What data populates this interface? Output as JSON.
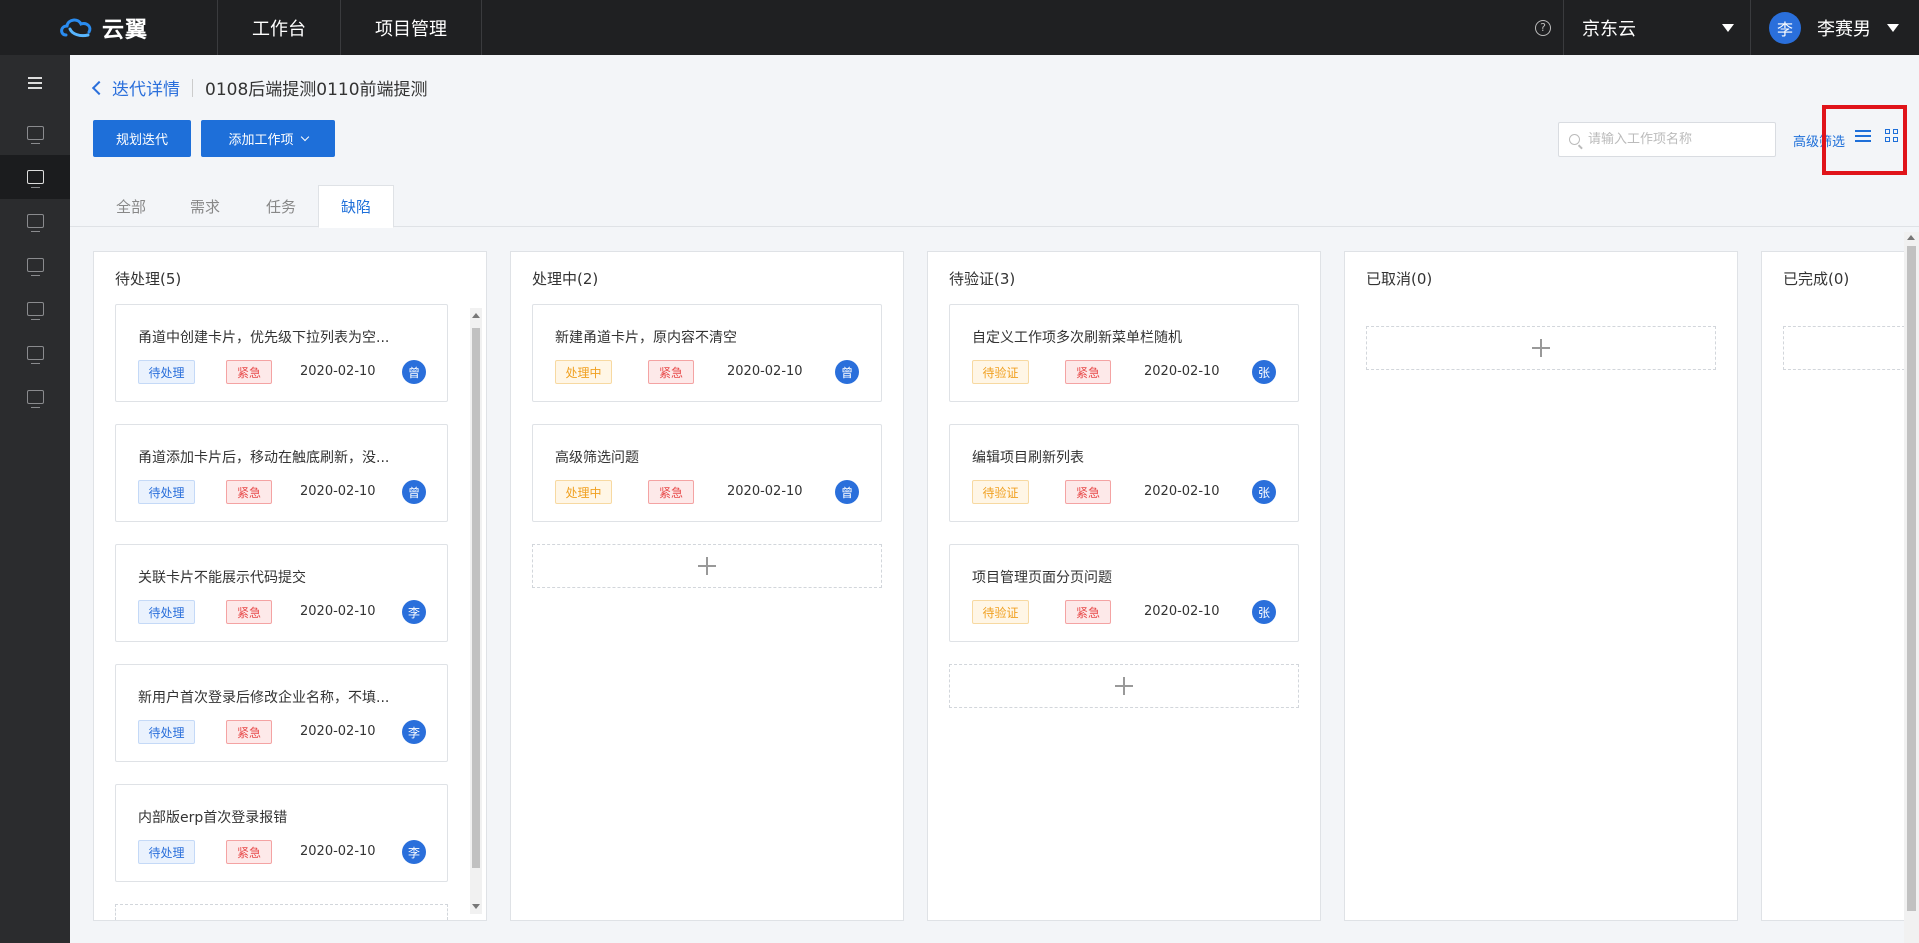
{
  "app": {
    "name": "云翼"
  },
  "top_nav": [
    {
      "label": "工作台"
    },
    {
      "label": "项目管理"
    }
  ],
  "org": {
    "name": "京东云"
  },
  "user": {
    "avatar": "李",
    "name": "李赛男"
  },
  "breadcrumb": {
    "back": "迭代详情",
    "title": "0108后端提测0110前端提测"
  },
  "toolbar": {
    "plan_label": "规划迭代",
    "add_label": "添加工作项",
    "search_placeholder": "请输入工作项名称",
    "advanced_filter": "高级筛选"
  },
  "tabs": [
    {
      "label": "全部"
    },
    {
      "label": "需求"
    },
    {
      "label": "任务"
    },
    {
      "label": "缺陷"
    }
  ],
  "columns": [
    {
      "title": "待处理(5)",
      "cards": [
        {
          "title": "甬道中创建卡片，优先级下拉列表为空...",
          "status": "待处理",
          "priority": "紧急",
          "date": "2020-02-10",
          "assignee": "曾"
        },
        {
          "title": "甬道添加卡片后，移动在触底刷新，没...",
          "status": "待处理",
          "priority": "紧急",
          "date": "2020-02-10",
          "assignee": "曾"
        },
        {
          "title": "关联卡片不能展示代码提交",
          "status": "待处理",
          "priority": "紧急",
          "date": "2020-02-10",
          "assignee": "李"
        },
        {
          "title": "新用户首次登录后修改企业名称，不填...",
          "status": "待处理",
          "priority": "紧急",
          "date": "2020-02-10",
          "assignee": "李"
        },
        {
          "title": "内部版erp首次登录报错",
          "status": "待处理",
          "priority": "紧急",
          "date": "2020-02-10",
          "assignee": "李"
        }
      ]
    },
    {
      "title": "处理中(2)",
      "cards": [
        {
          "title": "新建甬道卡片，原内容不清空",
          "status": "处理中",
          "priority": "紧急",
          "date": "2020-02-10",
          "assignee": "曾"
        },
        {
          "title": "高级筛选问题",
          "status": "处理中",
          "priority": "紧急",
          "date": "2020-02-10",
          "assignee": "曾"
        }
      ]
    },
    {
      "title": "待验证(3)",
      "cards": [
        {
          "title": "自定义工作项多次刷新菜单栏随机",
          "status": "待验证",
          "priority": "紧急",
          "date": "2020-02-10",
          "assignee": "张"
        },
        {
          "title": "编辑项目刷新列表",
          "status": "待验证",
          "priority": "紧急",
          "date": "2020-02-10",
          "assignee": "张"
        },
        {
          "title": "项目管理页面分页问题",
          "status": "待验证",
          "priority": "紧急",
          "date": "2020-02-10",
          "assignee": "张"
        }
      ]
    },
    {
      "title": "已取消(0)",
      "cards": []
    },
    {
      "title": "已完成(0)",
      "cards": []
    }
  ],
  "colors": {
    "accent": "#1e6fd9",
    "topbar": "#1f2022",
    "sidebar": "#2b2c2e",
    "urgent": "#e84b4b",
    "pending": "#2a6fdb",
    "in_progress": "#f0a020",
    "highlight_box": "#e0141a"
  }
}
